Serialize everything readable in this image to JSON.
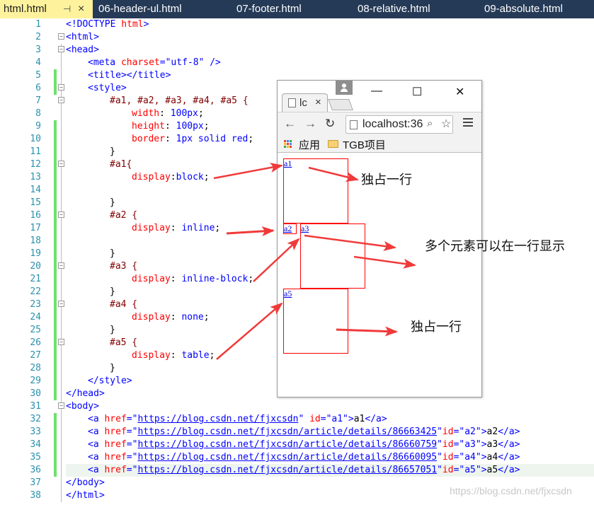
{
  "tabs": [
    {
      "label": "html.html",
      "active": true
    },
    {
      "label": "06-header-ul.html"
    },
    {
      "label": "07-footer.html"
    },
    {
      "label": "08-relative.html"
    },
    {
      "label": "09-absolute.html"
    }
  ],
  "tab_pin": "⊣",
  "tab_close": "×",
  "line_numbers": [
    "1",
    "2",
    "3",
    "4",
    "5",
    "6",
    "7",
    "8",
    "9",
    "10",
    "11",
    "12",
    "13",
    "14",
    "15",
    "16",
    "17",
    "18",
    "19",
    "20",
    "21",
    "22",
    "23",
    "24",
    "25",
    "26",
    "27",
    "28",
    "29",
    "30",
    "31",
    "32",
    "33",
    "34",
    "35",
    "36",
    "37",
    "38"
  ],
  "code": {
    "l1_doctype": "<!DOCTYPE",
    "l1_html": "html",
    "l1_end": ">",
    "l2": "<html>",
    "l3": "<head>",
    "l4_open": "<meta",
    "l4_attr": "charset",
    "l4_eq": "=",
    "l4_val": "\"utf-8\"",
    "l4_end": " />",
    "l5": "<title></title>",
    "l6": "<style>",
    "l7": "#a1, #a2, #a3, #a4, #a5 {",
    "l8_prop": "width",
    "l8_val": "100px",
    "l9_prop": "height",
    "l9_val": "100px",
    "l10_prop": "border",
    "l10_val": "1px solid red",
    "l11": "}",
    "l12": "#a1{",
    "l13_prop": "display",
    "l13_val": "block",
    "l15": "}",
    "l16": "#a2 {",
    "l17_prop": "display",
    "l17_val": "inline",
    "l19": "}",
    "l20": "#a3 {",
    "l21_prop": "display",
    "l21_val": "inline-block",
    "l22": "}",
    "l23": "#a4 {",
    "l24_prop": "display",
    "l24_val": "none",
    "l25": "}",
    "l26": "#a5 {",
    "l27_prop": "display",
    "l27_val": "table",
    "l28": "}",
    "l29": "</style>",
    "l30": "</head>",
    "l31": "<body>",
    "links": [
      {
        "url": "https://blog.csdn.net/fjxcsdn",
        "id": "\"a1\"",
        "text": "a1",
        "sep": " "
      },
      {
        "url": "https://blog.csdn.net/fjxcsdn/article/details/86663425",
        "id": "\"a2\"",
        "text": "a2",
        "sep": ""
      },
      {
        "url": "https://blog.csdn.net/fjxcsdn/article/details/86660759",
        "id": "\"a3\"",
        "text": "a3",
        "sep": ""
      },
      {
        "url": "https://blog.csdn.net/fjxcsdn/article/details/86660095",
        "id": "\"a4\"",
        "text": "a4",
        "sep": ""
      },
      {
        "url": "https://blog.csdn.net/fjxcsdn/article/details/86657051",
        "id": "\"a5\"",
        "text": "a5",
        "sep": ""
      }
    ],
    "l37": "</body>",
    "l38": "</html>"
  },
  "browser": {
    "tab_title": "lc",
    "tab_close": "×",
    "minimize": "—",
    "maximize": "☐",
    "close": "✕",
    "back": "←",
    "forward": "→",
    "reload": "↻",
    "url": "localhost:36",
    "zoom_glyph": "⌕",
    "star_glyph": "☆",
    "bookmark_apps": "应用",
    "bookmark_folder": "TGB项目",
    "links": [
      "a1",
      "a2",
      "a3",
      "a5"
    ]
  },
  "annotations": {
    "note1": "独占一行",
    "note2": "多个元素可以在一行显示",
    "note3": "独占一行",
    "arrow_color": "#f03a3a"
  },
  "watermark": "https://blog.csdn.net/fjxcsdn",
  "colors": {
    "tabbar_bg": "#253a56",
    "active_tab_bg": "#fff29d",
    "link_border": "#ff0000",
    "change_bar": "#6ee06e"
  }
}
